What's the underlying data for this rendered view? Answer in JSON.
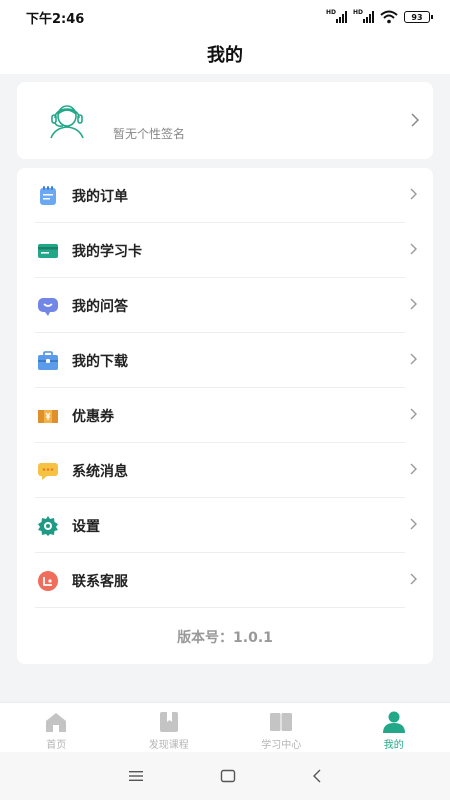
{
  "status_bar": {
    "time": "下午2:46",
    "signal1_label": "HD",
    "signal2_label": "HD",
    "battery": "93"
  },
  "header": {
    "title": "我的"
  },
  "profile": {
    "signature": "暂无个性签名",
    "avatar_icon": "user-headset-icon"
  },
  "menu": {
    "items": [
      {
        "label": "我的订单",
        "icon": "order-notepad-icon",
        "color": "#5b9ef0"
      },
      {
        "label": "我的学习卡",
        "icon": "card-icon",
        "color": "#22a889"
      },
      {
        "label": "我的问答",
        "icon": "chat-bubble-icon",
        "color": "#6b7fe0"
      },
      {
        "label": "我的下载",
        "icon": "briefcase-download-icon",
        "color": "#4a90e2"
      },
      {
        "label": "优惠券",
        "icon": "coupon-icon",
        "color": "#f0a93b"
      },
      {
        "label": "系统消息",
        "icon": "message-icon",
        "color": "#f5b731"
      },
      {
        "label": "设置",
        "icon": "gear-icon",
        "color": "#1f9a84"
      },
      {
        "label": "联系客服",
        "icon": "customer-service-icon",
        "color": "#ef6d5a"
      }
    ],
    "version": "版本号：1.0.1"
  },
  "tabbar": {
    "tabs": [
      {
        "label": "首页",
        "icon": "home-icon",
        "active": false
      },
      {
        "label": "发现课程",
        "icon": "bookmark-icon",
        "active": false
      },
      {
        "label": "学习中心",
        "icon": "open-book-icon",
        "active": false
      },
      {
        "label": "我的",
        "icon": "person-icon",
        "active": true
      }
    ],
    "active_color": "#22a889",
    "inactive_color": "#b5b5b5"
  },
  "system_nav": {
    "menu_icon": "menu-icon",
    "home_icon": "home-square-icon",
    "back_icon": "back-icon"
  }
}
